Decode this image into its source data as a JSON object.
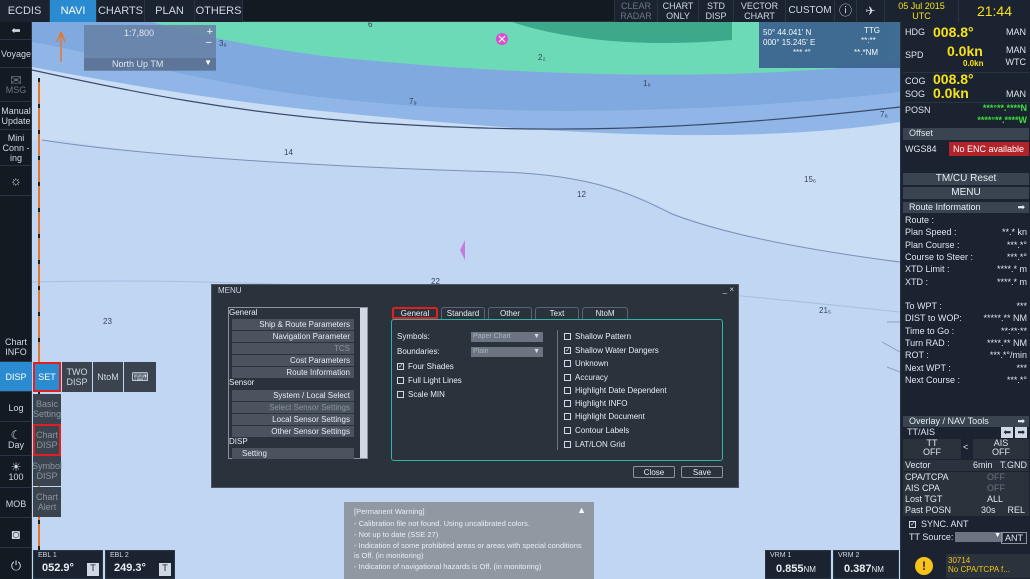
{
  "tabs": [
    "ECDIS",
    "NAVI",
    "CHARTS",
    "PLAN",
    "OTHERS"
  ],
  "topright": {
    "clear_radar": "CLEAR RADAR",
    "chart_only": "CHART ONLY",
    "std_disp": "STD DISP",
    "vector_chart": "VECTOR CHART",
    "custom": "CUSTOM",
    "date": "05 Jul 2015",
    "tz": "UTC",
    "time": "21:44"
  },
  "scale": {
    "value": "1:7,800",
    "orient": "North Up TM"
  },
  "cursor": {
    "lat": "50° 44.041' N",
    "lon": "000° 15.245' E",
    "rng": "*** *°",
    "ttg": "TTG",
    "ttg_val": "**:**",
    "nm": "**.*NM"
  },
  "left": {
    "voyage": "Voyage",
    "msg": "MSG",
    "manual": "Manual Update",
    "mini": "Mini Conn -ing",
    "chart_info": "Chart INFO",
    "disp": "DISP",
    "set": "SET",
    "two_disp": "TWO DISP",
    "ntom": "NtoM",
    "log": "Log",
    "basic": "Basic Setting",
    "chart_disp": "Chart DISP",
    "day": "Day",
    "hundred": "100",
    "symbol": "Symbol DISP",
    "mob": "MOB",
    "chart_alert": "Chart Alert"
  },
  "soundings": [
    "6",
    "3₉",
    "2₂",
    "1₆",
    "7₉",
    "7₈",
    "14",
    "15₆",
    "12",
    "22",
    "23",
    "21₅"
  ],
  "right": {
    "hdg_l": "HDG",
    "hdg": "008.8°",
    "man1": "MAN",
    "spd_l": "SPD",
    "spd": "0.0kn",
    "spd2": "0.0kn",
    "man2": "MAN",
    "wtc": "WTC",
    "cog_l": "COG",
    "cog": "008.8°",
    "sog_l": "SOG",
    "sog": "0.0kn",
    "man3": "MAN",
    "posn_l": "POSN",
    "lat": "***°**.****N",
    "lon": "****°**.****W",
    "offset": "Offset",
    "wgs": "WGS84",
    "enc": "No ENC available",
    "tmcu": "TM/CU Reset",
    "menu": "MENU",
    "route_info": "Route Information",
    "route_rows": [
      [
        "Route :",
        ""
      ],
      [
        "Plan Speed :",
        "**.* kn"
      ],
      [
        "Plan Course :",
        "***.*°"
      ],
      [
        "Course to Steer :",
        "***.*°"
      ],
      [
        "XTD Limit :",
        "****.* m"
      ],
      [
        "XTD :",
        "****.* m"
      ],
      [
        "",
        ""
      ],
      [
        "To WPT :",
        "***"
      ],
      [
        "DIST to WOP:",
        "*****.** NM"
      ],
      [
        "Time to Go :",
        "**:**:**"
      ],
      [
        "Turn RAD :",
        "****.** NM"
      ],
      [
        "ROT :",
        "***.*°/min"
      ],
      [
        "Next WPT :",
        "***"
      ],
      [
        "Next Course :",
        "***.*°"
      ]
    ],
    "overlay": "Overlay / NAV Tools",
    "ttais": "TT/AIS",
    "tt": "TT",
    "tt_v": "OFF",
    "ais": "AIS",
    "ais_v": "OFF",
    "vector": "Vector",
    "vector_v": "6min",
    "tgnd": "T.GND",
    "cpa": "CPA/TCPA",
    "cpa_v": "OFF",
    "aiscpa": "AIS CPA",
    "aiscpa_v": "OFF",
    "lost": "Lost TGT",
    "lost_v": "ALL",
    "past": "Past POSN",
    "past_v": "30s",
    "rel": "REL",
    "sync": "SYNC. ANT",
    "ttsrc": "TT Source:",
    "ant": "ANT",
    "alarm_code": "30714",
    "alarm_text": "No CPA/TCPA f..."
  },
  "menu": {
    "title": "MENU",
    "close_x": "_ ×",
    "cats": [
      "General",
      "Sensor",
      "DISP"
    ],
    "general_items": [
      "Ship & Route Parameters",
      "Navigation Parameter",
      "TCS",
      "Cost Parameters",
      "Route Information"
    ],
    "sensor_items": [
      "System / Local Select",
      "Select Sensor Settings",
      "Local Sensor Settings",
      "Other Sensor Settings"
    ],
    "disp_items": [
      "Setting"
    ],
    "tabs": [
      "General",
      "Standard",
      "Other",
      "Text",
      "NtoM"
    ],
    "symbols_l": "Symbols:",
    "symbols_v": "Paper Chart",
    "boundaries_l": "Boundaries:",
    "boundaries_v": "Plain",
    "left_opts": [
      [
        "Four Shades",
        true
      ],
      [
        "Full Light Lines",
        false
      ],
      [
        "Scale MIN",
        false
      ]
    ],
    "right_opts": [
      [
        "Shallow Pattern",
        false
      ],
      [
        "Shallow Water Dangers",
        true
      ],
      [
        "Unknown",
        false
      ],
      [
        "Accuracy",
        false
      ],
      [
        "Highlight Date Dependent",
        false
      ],
      [
        "Highlight INFO",
        false
      ],
      [
        "Highlight Document",
        false
      ],
      [
        "Contour Labels",
        false
      ],
      [
        "LAT/LON Grid",
        false
      ]
    ],
    "close": "Close",
    "save": "Save"
  },
  "warning": {
    "title": "[Permanent Warning]",
    "lines": [
      "- Calibration file not found. Using uncalibrated colors.",
      "- Not up to date (SSE 27)",
      "- Indication of some prohibited areas or areas with special conditions is Off. (in monitoring)",
      "- Indication of navigational hazards is Off. (in monitoring)"
    ]
  },
  "bottom": {
    "ebl1": "EBL 1",
    "ebl1_v": "052.9°",
    "ebl2": "EBL 2",
    "ebl2_v": "249.3°",
    "vrm1": "VRM 1",
    "vrm1_v": "0.855",
    "vrm2": "VRM 2",
    "vrm2_v": "0.387",
    "nm": "NM",
    "t": "T"
  }
}
